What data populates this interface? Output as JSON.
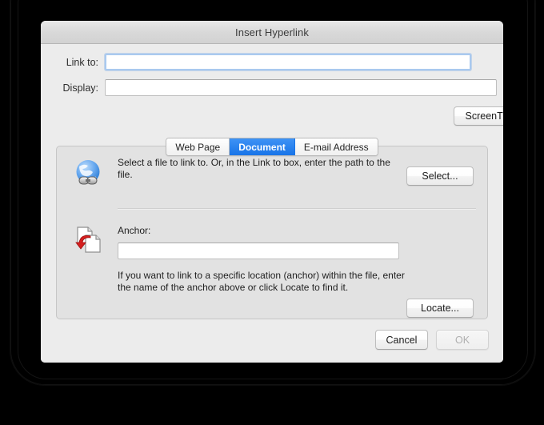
{
  "window": {
    "title": "Insert Hyperlink"
  },
  "form": {
    "link_to_label": "Link to:",
    "link_to_value": "",
    "link_to_placeholder": "",
    "display_label": "Display:",
    "display_value": "",
    "display_placeholder": "",
    "stepper_icon": "chevron-up-down-icon",
    "screentip_label": "ScreenTip..."
  },
  "tabs": [
    {
      "label": "Web Page",
      "active": false
    },
    {
      "label": "Document",
      "active": true
    },
    {
      "label": "E-mail Address",
      "active": false
    }
  ],
  "panel": {
    "file_section": {
      "icon": "globe-link-icon",
      "description": "Select a file to link to. Or, in the Link to box, enter the path to the file.",
      "button_label": "Select..."
    },
    "anchor_section": {
      "icon": "document-anchor-icon",
      "label": "Anchor:",
      "value": "",
      "placeholder": "",
      "button_label": "Locate...",
      "hint": "If you want to link to a specific location (anchor) within the file, enter the name of the anchor above or click Locate to find it."
    }
  },
  "footer": {
    "cancel_label": "Cancel",
    "ok_label": "OK",
    "ok_disabled": true
  },
  "colors": {
    "accent": "#1874e8",
    "dialog_background": "#ececec",
    "panel_background": "#e2e2e2",
    "focus_ring": "#a9c9ef"
  }
}
